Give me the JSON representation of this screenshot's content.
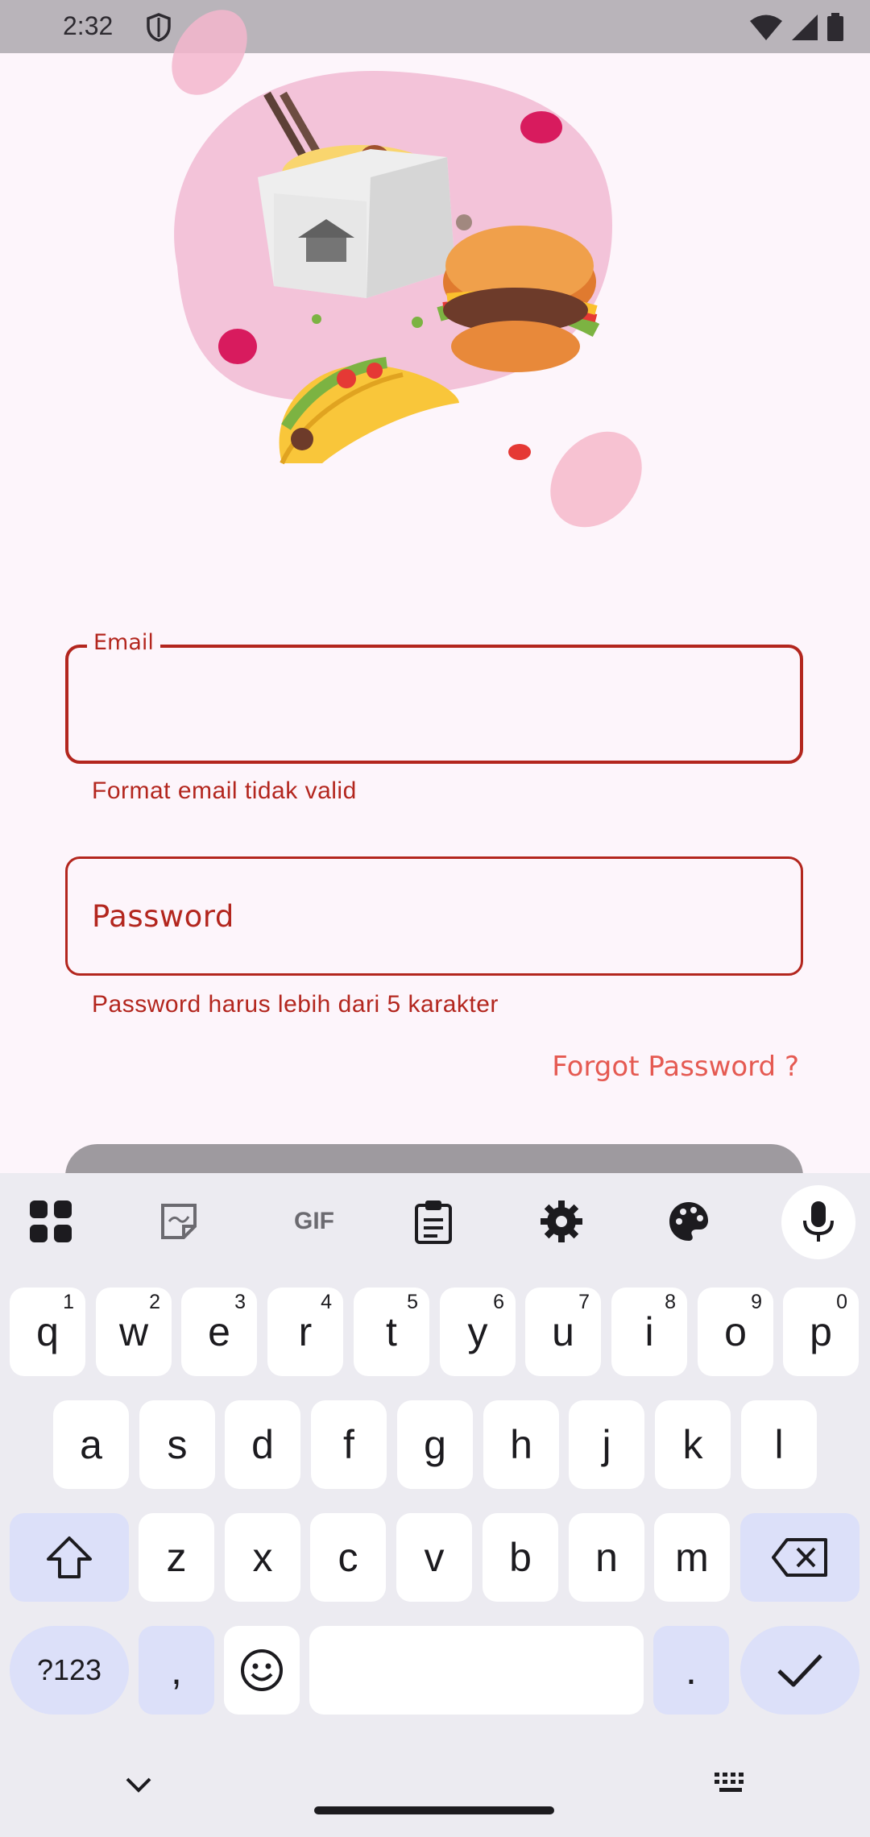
{
  "status_bar": {
    "time": "2:32"
  },
  "form": {
    "email": {
      "label": "Email",
      "value": "",
      "error": "Format email tidak valid"
    },
    "password": {
      "placeholder": "Password",
      "error": "Password harus lebih dari 5 karakter"
    },
    "forgot_label": "Forgot Password ?"
  },
  "keyboard": {
    "toolbar": {
      "gif_label": "GIF"
    },
    "row1": [
      {
        "key": "q",
        "hint": "1"
      },
      {
        "key": "w",
        "hint": "2"
      },
      {
        "key": "e",
        "hint": "3"
      },
      {
        "key": "r",
        "hint": "4"
      },
      {
        "key": "t",
        "hint": "5"
      },
      {
        "key": "y",
        "hint": "6"
      },
      {
        "key": "u",
        "hint": "7"
      },
      {
        "key": "i",
        "hint": "8"
      },
      {
        "key": "o",
        "hint": "9"
      },
      {
        "key": "p",
        "hint": "0"
      }
    ],
    "row2": [
      "a",
      "s",
      "d",
      "f",
      "g",
      "h",
      "j",
      "k",
      "l"
    ],
    "row3": [
      "z",
      "x",
      "c",
      "v",
      "b",
      "n",
      "m"
    ],
    "row4": {
      "symbols": "?123",
      "comma": ",",
      "period": "."
    }
  },
  "colors": {
    "error": "#b3261e",
    "link": "#e55a52",
    "background": "#fdf5fb",
    "keyboard_bg": "#ecebf1",
    "key_special": "#dce0f9"
  }
}
